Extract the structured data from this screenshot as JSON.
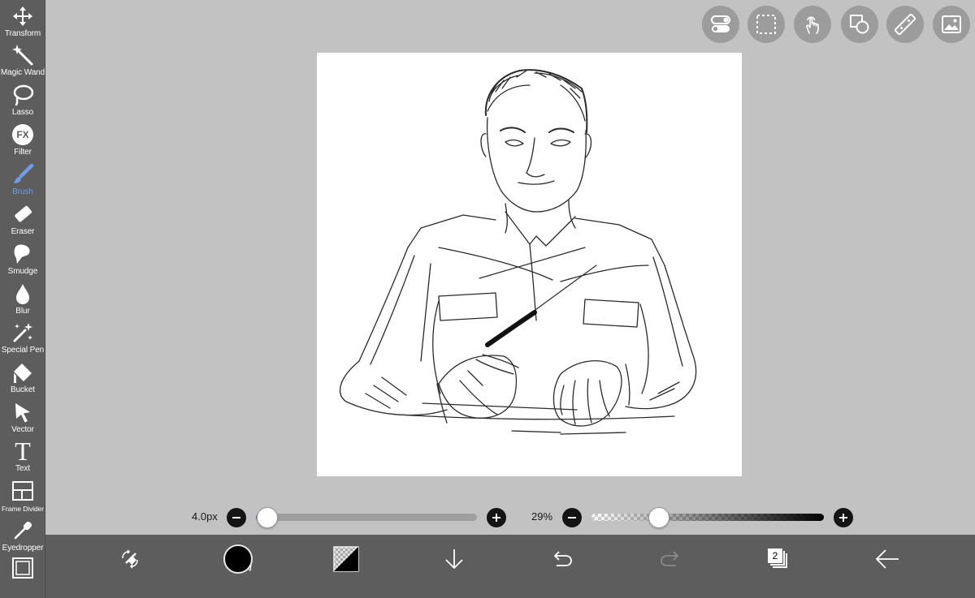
{
  "tools": [
    {
      "label": "Transform",
      "icon": "move-arrows-icon"
    },
    {
      "label": "Magic Wand",
      "icon": "magic-wand-icon"
    },
    {
      "label": "Lasso",
      "icon": "lasso-icon"
    },
    {
      "label": "Filter",
      "icon": "fx-icon"
    },
    {
      "label": "Brush",
      "icon": "brush-icon",
      "active": true
    },
    {
      "label": "Eraser",
      "icon": "eraser-icon"
    },
    {
      "label": "Smudge",
      "icon": "smudge-icon"
    },
    {
      "label": "Blur",
      "icon": "droplet-icon"
    },
    {
      "label": "Special Pen",
      "icon": "sparkle-pen-icon"
    },
    {
      "label": "Bucket",
      "icon": "bucket-icon"
    },
    {
      "label": "Vector",
      "icon": "cursor-arrow-icon"
    },
    {
      "label": "Text",
      "icon": "text-t-icon"
    },
    {
      "label": "Frame Divider",
      "icon": "frame-divider-icon"
    },
    {
      "label": "Eyedropper",
      "icon": "eyedropper-icon"
    },
    {
      "label": "",
      "icon": "canvas-frame-icon"
    }
  ],
  "filter_icon_text": "FX",
  "text_tool_glyph": "T",
  "top_buttons": [
    "toggle-icon",
    "selection-icon",
    "touch-icon",
    "shapes-icon",
    "ruler-icon",
    "material-image-icon"
  ],
  "brush_size": {
    "label": "4.0px",
    "value": 4.0,
    "fraction": 0.05
  },
  "opacity": {
    "label": "29%",
    "value": 29
  },
  "bottom_bar": {
    "color_badge": "4",
    "layers_count": "2",
    "icons": [
      "quick-menu-icon",
      "color-swatch-icon",
      "fill-pattern-icon",
      "save-down-arrow-icon",
      "undo-icon",
      "redo-icon",
      "layers-icon",
      "back-arrow-icon"
    ]
  },
  "colors": {
    "accent": "#6f9ce8",
    "panel": "#5d5d5d",
    "background": "#c2c2c2",
    "slider_fill": "#4a74c9",
    "current_color": "#000000"
  }
}
